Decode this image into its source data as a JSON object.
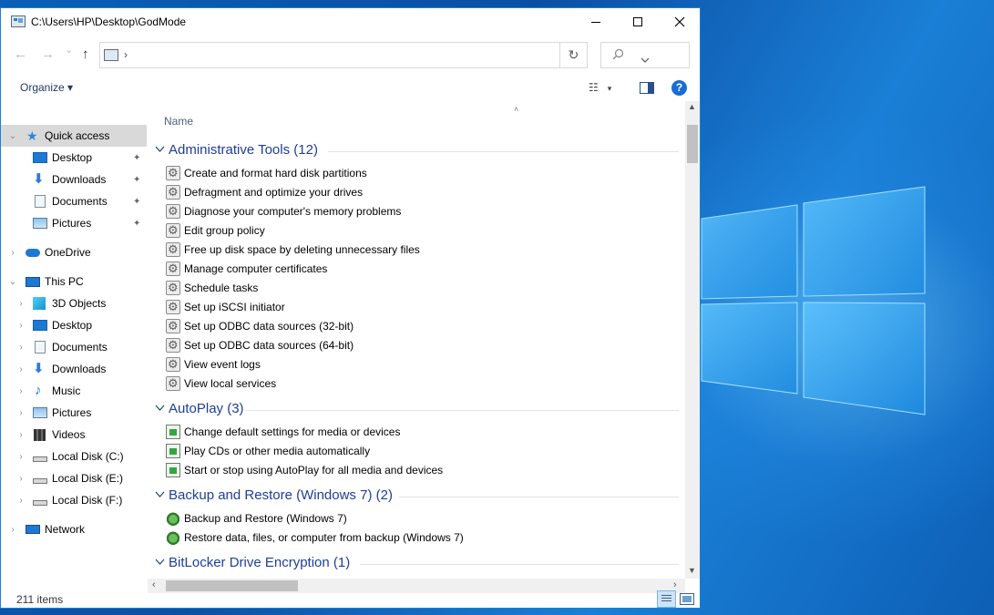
{
  "window": {
    "title": "C:\\Users\\HP\\Desktop\\GodMode",
    "minimize_glyph": "—",
    "maximize_glyph": "☐",
    "close_glyph": "✕"
  },
  "address_bar": {
    "back_glyph": "←",
    "forward_glyph": "→",
    "recent_glyph": "⌄",
    "up_glyph": "↑",
    "path_chevron": "›",
    "dropdown_glyph": "⌄",
    "refresh_glyph": "↻",
    "search_placeholder": "",
    "search_icon_glyph": "⚲"
  },
  "command_bar": {
    "organize_label": "Organize ▾",
    "view_options_glyph": "☷",
    "view_dropdown_glyph": "▾",
    "help_label": "?"
  },
  "nav_pane": {
    "quick_access": {
      "label": "Quick access",
      "items": [
        "Desktop",
        "Downloads",
        "Documents",
        "Pictures"
      ]
    },
    "onedrive": "OneDrive",
    "this_pc": {
      "label": "This PC",
      "items": [
        "3D Objects",
        "Desktop",
        "Documents",
        "Downloads",
        "Music",
        "Pictures",
        "Videos",
        "Local Disk (C:)",
        "Local Disk (E:)",
        "Local Disk (F:)"
      ]
    },
    "network": "Network",
    "pin_glyph": "📌"
  },
  "content": {
    "column_name": "Name",
    "sort_glyph": "˄",
    "groups": [
      {
        "title": "Administrative Tools (12)",
        "items": [
          "Create and format hard disk partitions",
          "Defragment and optimize your drives",
          "Diagnose your computer's memory problems",
          "Edit group policy",
          "Free up disk space by deleting unnecessary files",
          "Manage computer certificates",
          "Schedule tasks",
          "Set up iSCSI initiator",
          "Set up ODBC data sources (32-bit)",
          "Set up ODBC data sources (64-bit)",
          "View event logs",
          "View local services"
        ]
      },
      {
        "title": "AutoPlay (3)",
        "items": [
          "Change default settings for media or devices",
          "Play CDs or other media automatically",
          "Start or stop using AutoPlay for all media and devices"
        ]
      },
      {
        "title": "Backup and Restore (Windows 7) (2)",
        "items": [
          "Backup and Restore (Windows 7)",
          "Restore data, files, or computer from backup (Windows 7)"
        ]
      },
      {
        "title": "BitLocker Drive Encryption (1)",
        "items": []
      }
    ]
  },
  "status_bar": {
    "item_count": "211 items"
  },
  "colors": {
    "accent": "#1883d7",
    "group_title": "#1e3e9a",
    "selection": "#d9d9d9"
  }
}
